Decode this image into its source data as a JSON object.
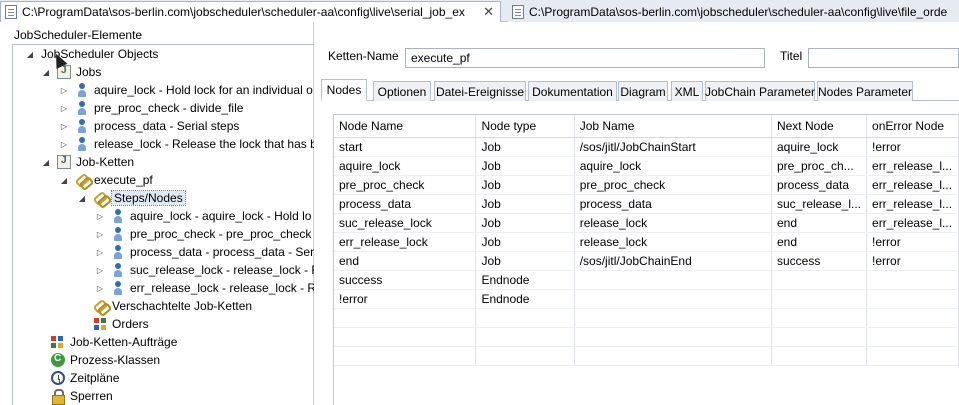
{
  "editor_tabs": [
    {
      "label": "C:\\ProgramData\\sos-berlin.com\\jobscheduler\\scheduler-aa\\config\\live\\serial_job_ex",
      "close": "✕"
    },
    {
      "label": "C:\\ProgramData\\sos-berlin.com\\jobscheduler\\scheduler-aa\\config\\live\\file_orde"
    }
  ],
  "left_panel": {
    "title": "JobScheduler-Elemente",
    "tree": {
      "root": "JobScheduler Objects",
      "jobs": "Jobs",
      "job_items": [
        "aquire_lock - Hold lock for an individual o",
        "pre_proc_check - divide_file",
        "process_data - Serial steps",
        "release_lock - Release the lock that has be"
      ],
      "job_chains": "Job-Ketten",
      "chain_name": "execute_pf",
      "steps_nodes": "Steps/Nodes",
      "step_items": [
        "aquire_lock - aquire_lock - Hold lo",
        "pre_proc_check - pre_proc_check -",
        "process_data - process_data - Seria",
        "suc_release_lock - release_lock - Re",
        "err_release_lock - release_lock - Re"
      ],
      "nested_chains": "Verschachtelte Job-Ketten",
      "orders": "Orders",
      "chain_orders": "Job-Ketten-Aufträge",
      "process_classes": "Prozess-Klassen",
      "schedules": "Zeitpläne",
      "locks": "Sperren"
    }
  },
  "form": {
    "chain_name_label": "Ketten-Name",
    "chain_name_value": "execute_pf",
    "title_label": "Titel",
    "title_value": ""
  },
  "tabs": [
    "Nodes",
    "Optionen",
    "Datei-Ereignisse",
    "Dokumentation",
    "Diagram",
    "XML",
    "JobChain Parameter",
    "Nodes Parameter"
  ],
  "table": {
    "headers": [
      "Node Name",
      "Node type",
      "Job Name",
      "Next Node",
      "onError Node"
    ],
    "rows": [
      [
        "start",
        "Job",
        "/sos/jitl/JobChainStart",
        "aquire_lock",
        "!error"
      ],
      [
        "aquire_lock",
        "Job",
        "aquire_lock",
        "pre_proc_ch...",
        "err_release_l..."
      ],
      [
        "pre_proc_check",
        "Job",
        "pre_proc_check",
        "process_data",
        "err_release_l..."
      ],
      [
        "process_data",
        "Job",
        "process_data",
        "suc_release_l...",
        "err_release_l..."
      ],
      [
        "suc_release_lock",
        "Job",
        "release_lock",
        "end",
        "err_release_l..."
      ],
      [
        "err_release_lock",
        "Job",
        "release_lock",
        "end",
        "!error"
      ],
      [
        "end",
        "Job",
        "/sos/jitl/JobChainEnd",
        "success",
        "!error"
      ],
      [
        "success",
        "Endnode",
        "",
        "",
        ""
      ],
      [
        "!error",
        "Endnode",
        "",
        "",
        ""
      ],
      [
        "",
        "",
        "",
        "",
        ""
      ],
      [
        "",
        "",
        "",
        "",
        ""
      ],
      [
        "",
        "",
        "",
        "",
        ""
      ]
    ]
  }
}
